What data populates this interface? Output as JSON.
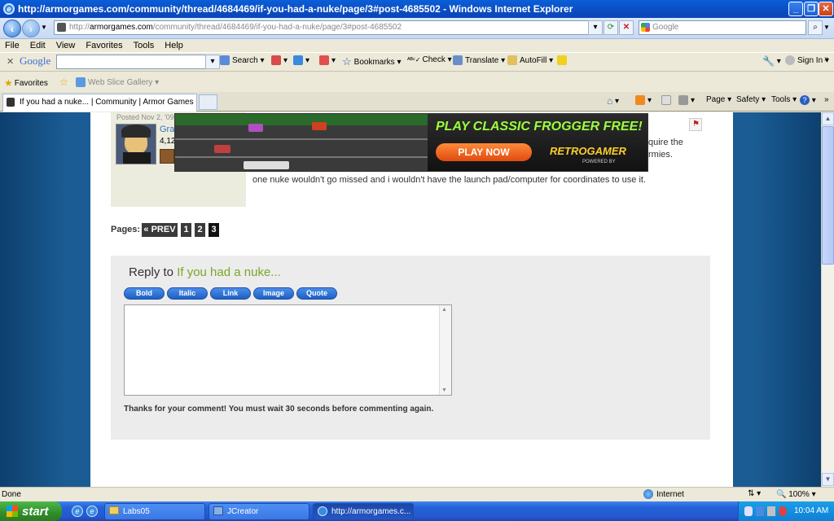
{
  "window": {
    "title": "http://armorgames.com/community/thread/4684469/if-you-had-a-nuke/page/3#post-4685502 - Windows Internet Explorer",
    "minimize": "_",
    "maximize": "❐",
    "close": "✕"
  },
  "address": {
    "prefix": "http://",
    "domain": "armorgames.com",
    "path": "/community/thread/4684469/if-you-had-a-nuke/page/3#post-4685502",
    "search_placeholder": "Google"
  },
  "menu": [
    "File",
    "Edit",
    "View",
    "Favorites",
    "Tools",
    "Help"
  ],
  "google_toolbar": {
    "logo": "Google",
    "search": "Search",
    "bookmarks": "Bookmarks",
    "check": "Check",
    "translate": "Translate",
    "autofill": "AutoFill",
    "signin": "Sign In"
  },
  "favorites": {
    "label": "Favorites",
    "web_slice": "Web Slice Gallery"
  },
  "tab": {
    "label": "If you had a nuke... | Community | Armor Games"
  },
  "command_bar": {
    "page": "Page",
    "safety": "Safety",
    "tools": "Tools"
  },
  "post": {
    "posted": "Posted Nov 2, '09 a",
    "username": "Gra",
    "count": "4,12",
    "body_frag1": "quire the",
    "body_frag2": "rmies.",
    "body_line": "one nuke wouldn't go missed and i wouldn't have the launch pad/computer for coordinates to use it."
  },
  "ad": {
    "headline": "PLAY CLASSIC FROGGER FREE!",
    "cta": "PLAY NOW",
    "brand": "RETROGAMER",
    "powered": "POWERED BY"
  },
  "pagination": {
    "label": "Pages:",
    "prev": "« PREV",
    "pages": [
      "1",
      "2",
      "3"
    ]
  },
  "reply": {
    "prefix": "Reply to",
    "thread_title": "If you had a nuke...",
    "buttons": [
      "Bold",
      "Italic",
      "Link",
      "Image",
      "Quote"
    ],
    "notice": "Thanks for your comment! You must wait 30 seconds before commenting again."
  },
  "status": {
    "text": "Done",
    "zone": "Internet",
    "zoom": "100%"
  },
  "taskbar": {
    "start": "start",
    "items": [
      "Labs05",
      "JCreator",
      "http://armorgames.c..."
    ],
    "clock": "10:04 AM"
  },
  "colors": {
    "accent_green": "#7aa62a",
    "link_blue": "#3b6fb6",
    "xp_blue": "#2458d0"
  }
}
